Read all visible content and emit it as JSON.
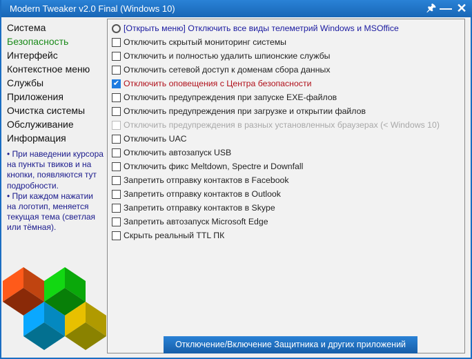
{
  "window": {
    "title": "Modern Tweaker v2.0 Final (Windows 10)",
    "pin_icon": "pin-icon",
    "minimize_icon": "minimize-icon",
    "close_icon": "close-icon"
  },
  "sidebar": {
    "items": [
      {
        "label": "Система",
        "active": false
      },
      {
        "label": "Безопасность",
        "active": true
      },
      {
        "label": "Интерфейс",
        "active": false
      },
      {
        "label": "Контекстное меню",
        "active": false
      },
      {
        "label": "Службы",
        "active": false
      },
      {
        "label": "Приложения",
        "active": false
      },
      {
        "label": "Очистка системы",
        "active": false
      },
      {
        "label": "Обслуживание",
        "active": false
      },
      {
        "label": "Информация",
        "active": false
      }
    ],
    "info": "• При наведении курсора на пункты твиков и на кнопки, появляются тут подробности.\n• При каждом нажатии на логотип, меняется текущая тема (светлая или тёмная).",
    "logo_colors": [
      "#ff5a1a",
      "#12d812",
      "#0aa8ff",
      "#e8c000"
    ]
  },
  "options": [
    {
      "label": "[Открыть меню] Отключить все виды телеметрий Windows и MSOffice",
      "type": "radio",
      "style": "blue"
    },
    {
      "label": "Отключить скрытый мониторинг системы",
      "type": "checkbox",
      "checked": false
    },
    {
      "label": "Отключить и полностью удалить шпионские службы",
      "type": "checkbox",
      "checked": false
    },
    {
      "label": "Отключить сетевой доступ к доменам сбора данных",
      "type": "checkbox",
      "checked": false
    },
    {
      "label": "Отключить оповещения с Центра безопасности",
      "type": "checkbox",
      "checked": true,
      "style": "red"
    },
    {
      "label": "Отключить предупреждения при запуске EXE-файлов",
      "type": "checkbox",
      "checked": false
    },
    {
      "label": "Отключить предупреждения при загрузке и открытии файлов",
      "type": "checkbox",
      "checked": false
    },
    {
      "label": "Отключить предупреждения в разных установленных браузерах (< Windows 10)",
      "type": "checkbox",
      "checked": false,
      "style": "dis"
    },
    {
      "label": "Отключить UAC",
      "type": "checkbox",
      "checked": false
    },
    {
      "label": "Отключить автозапуск USB",
      "type": "checkbox",
      "checked": false
    },
    {
      "label": "Отключить фикс Meltdown, Spectre и Downfall",
      "type": "checkbox",
      "checked": false
    },
    {
      "label": "Запретить отправку контактов в Facebook",
      "type": "checkbox",
      "checked": false
    },
    {
      "label": "Запретить отправку контактов в Outlook",
      "type": "checkbox",
      "checked": false
    },
    {
      "label": "Запретить отправку контактов в Skype",
      "type": "checkbox",
      "checked": false
    },
    {
      "label": "Запретить автозапуск Microsoft Edge",
      "type": "checkbox",
      "checked": false
    },
    {
      "label": "Скрыть реальный TTL ПК",
      "type": "checkbox",
      "checked": false
    }
  ],
  "bottom_button": "Отключение/Включение Защитника и других приложений"
}
